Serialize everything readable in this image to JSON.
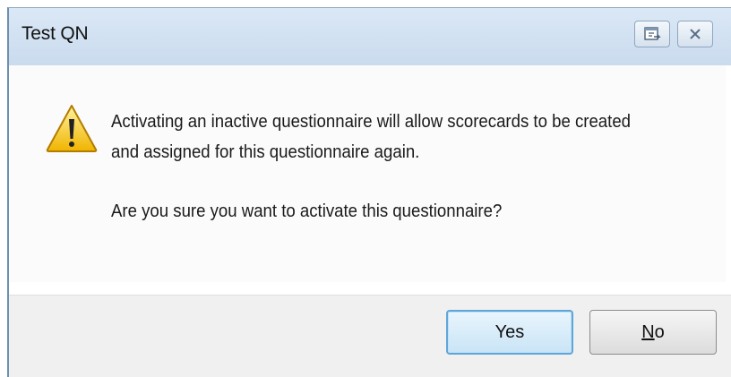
{
  "window": {
    "title": "Test QN",
    "accent_color": "#cfdfef"
  },
  "titlebar_buttons": {
    "help_icon": "help-icon",
    "close_icon": "close-icon"
  },
  "message": {
    "icon": "warning-icon",
    "line1": "Activating an inactive questionnaire will allow scorecards to be created",
    "line2": "and assigned for this questionnaire again.",
    "question": "Are you sure you want to activate this questionnaire?"
  },
  "buttons": {
    "yes_label": "Yes",
    "no_label_mnemonic": "N",
    "no_label_rest": "o",
    "default_button_color": "#5fa6d8"
  }
}
